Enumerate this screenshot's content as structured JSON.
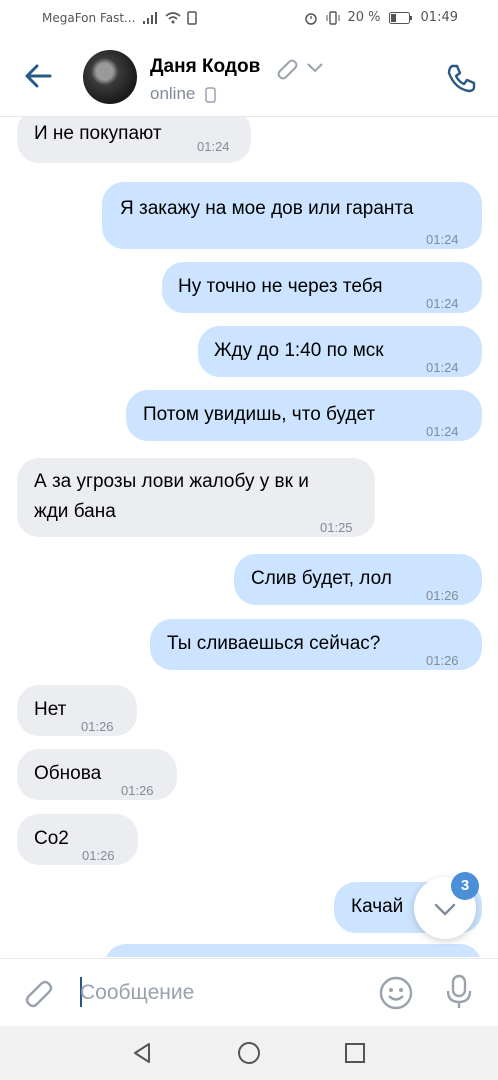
{
  "status_bar": {
    "carrier": "MegaFon Fast...",
    "battery": "20 %",
    "time": "01:49"
  },
  "header": {
    "contact_name": "Даня Кодов",
    "status": "online"
  },
  "messages": [
    {
      "direction": "in",
      "text": "И не покупают",
      "time": "01:24"
    },
    {
      "direction": "out",
      "text": "Я закажу на мое дов или гаранта",
      "time": "01:24"
    },
    {
      "direction": "out",
      "text": "Ну точно не через тебя",
      "time": "01:24"
    },
    {
      "direction": "out",
      "text": "Жду до 1:40 по мск",
      "time": "01:24"
    },
    {
      "direction": "out",
      "text": "Потом увидишь, что будет",
      "time": "01:24"
    },
    {
      "direction": "in",
      "text_line1": "А за угрозы лови жалобу у вк и",
      "text_line2": "жди бана",
      "time": "01:25"
    },
    {
      "direction": "out",
      "text": "Слив будет, лол",
      "time": "01:26"
    },
    {
      "direction": "out",
      "text": "Ты сливаешься сейчас?",
      "time": "01:26"
    },
    {
      "direction": "in",
      "text": "Нет",
      "time": "01:26"
    },
    {
      "direction": "in",
      "text": "Обнова",
      "time": "01:26"
    },
    {
      "direction": "in",
      "text": "Co2",
      "time": "01:26"
    },
    {
      "direction": "out",
      "text": "Качай",
      "time": ""
    }
  ],
  "scroll_down": {
    "unread_count": "3"
  },
  "composer": {
    "placeholder": "Сообщение"
  },
  "colors": {
    "accent": "#2a5885",
    "in_bubble": "#ebedf0",
    "out_bubble": "#cce4ff",
    "badge": "#4a8fd8"
  },
  "icons": [
    "back-arrow-icon",
    "paperclip-icon",
    "chevron-down-icon",
    "phone-call-icon",
    "smile-icon",
    "microphone-icon",
    "attach-icon",
    "nav-back-icon",
    "nav-home-icon",
    "nav-recents-icon"
  ]
}
